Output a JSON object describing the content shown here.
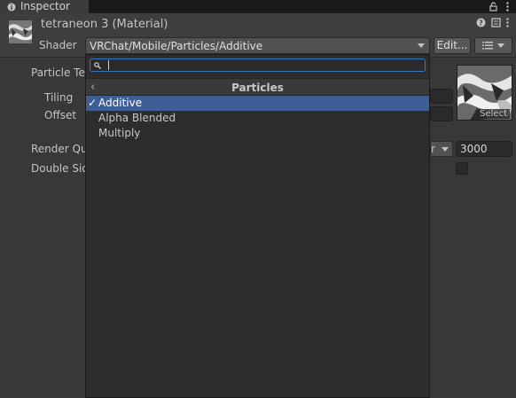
{
  "window": {
    "tab_label": "Inspector",
    "tab_icons": [
      "lock-icon",
      "more-icon"
    ]
  },
  "header": {
    "title": "tetraneon 3 (Material)",
    "shader_label": "Shader",
    "shader_value": "VRChat/Mobile/Particles/Additive",
    "edit_label": "Edit...",
    "icons": [
      "help-icon",
      "preset-icon",
      "more-icon"
    ]
  },
  "properties": {
    "particle_texture": "Particle Te",
    "tiling": "Tiling",
    "offset": "Offset",
    "render_queue": "Render Qu",
    "render_queue_mode": "r",
    "render_queue_value": "3000",
    "double_sided": "Double Sid",
    "texture_select": "Select"
  },
  "dropdown": {
    "search_value": "",
    "category": "Particles",
    "items": [
      {
        "label": "Additive",
        "selected": true
      },
      {
        "label": "Alpha Blended",
        "selected": false
      },
      {
        "label": "Multiply",
        "selected": false
      }
    ]
  },
  "colors": {
    "background": "#383838",
    "selection": "#3d5f96",
    "search_focus": "#3a79bb"
  }
}
